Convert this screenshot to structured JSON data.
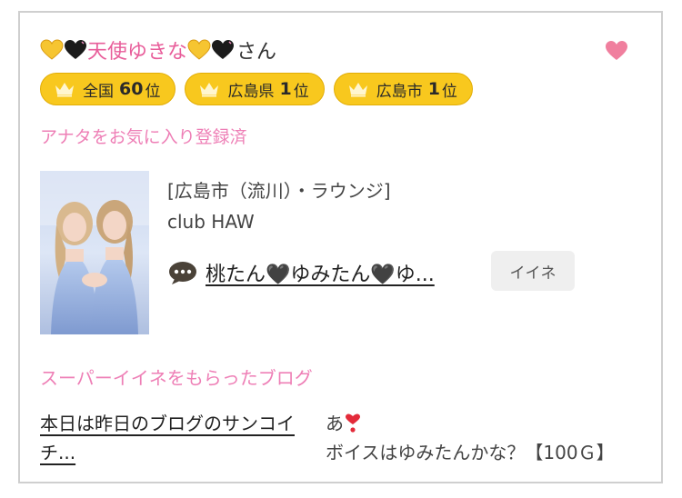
{
  "profile": {
    "name": "天使ゆきな",
    "suffix": "さん"
  },
  "favorite": {
    "icon": "heart-icon",
    "color": "#f07f9e"
  },
  "ranks": [
    {
      "label": "全国",
      "num": "60",
      "unit": "位"
    },
    {
      "label": "広島県",
      "num": "1",
      "unit": "位"
    },
    {
      "label": "広島市",
      "num": "1",
      "unit": "位"
    }
  ],
  "fav_status": "アナタをお気に入り登録済",
  "shop": {
    "area": "[広島市（流川）・ラウンジ]",
    "name": "club HAW"
  },
  "blog": {
    "title": "桃たん🖤ゆみたん🖤ゆ...",
    "iine_label": "イイネ"
  },
  "super_iine": {
    "heading": "スーパーイイネをもらったブログ",
    "post_title": "本日は昨日のブログのサンコイチ...",
    "comment_before": "あ",
    "comment_after": "ボイスはゆみたんかな？【100Ｇ】"
  },
  "colors": {
    "pink_text": "#ee7fb6",
    "gold_badge": "#f8c81e",
    "accent_heart": "#f07f9e"
  }
}
